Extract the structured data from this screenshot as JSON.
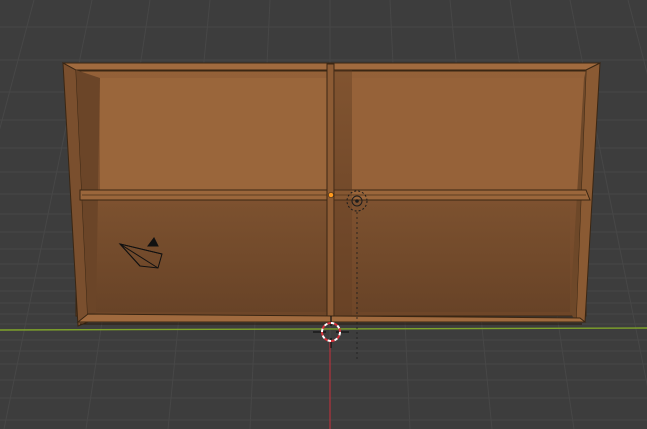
{
  "app": {
    "name": "",
    "window_title": ""
  },
  "viewport": {
    "mode": "3D viewport",
    "view": "perspective",
    "background": "#3d3d3d",
    "grid_color": "#4a4a4a",
    "x_axis_color": "#7fa42a",
    "z_axis_color": "#a3343c"
  },
  "scene": {
    "objects": [
      {
        "id": "shelf",
        "type": "mesh",
        "icon": "cabinet-frame",
        "color": "#8c5d36",
        "selected": false
      },
      {
        "id": "camera",
        "type": "camera",
        "icon": "camera-wireframe-icon",
        "selected": false
      },
      {
        "id": "light",
        "type": "light",
        "icon": "point-light-icon",
        "selected": false
      }
    ],
    "origin_marker": {
      "icon": "object-origin-dot",
      "color": "#ff9a1f"
    },
    "cursor": {
      "icon": "3d-cursor-icon",
      "color_a": "#ffffff",
      "color_b": "#d9303a"
    }
  }
}
